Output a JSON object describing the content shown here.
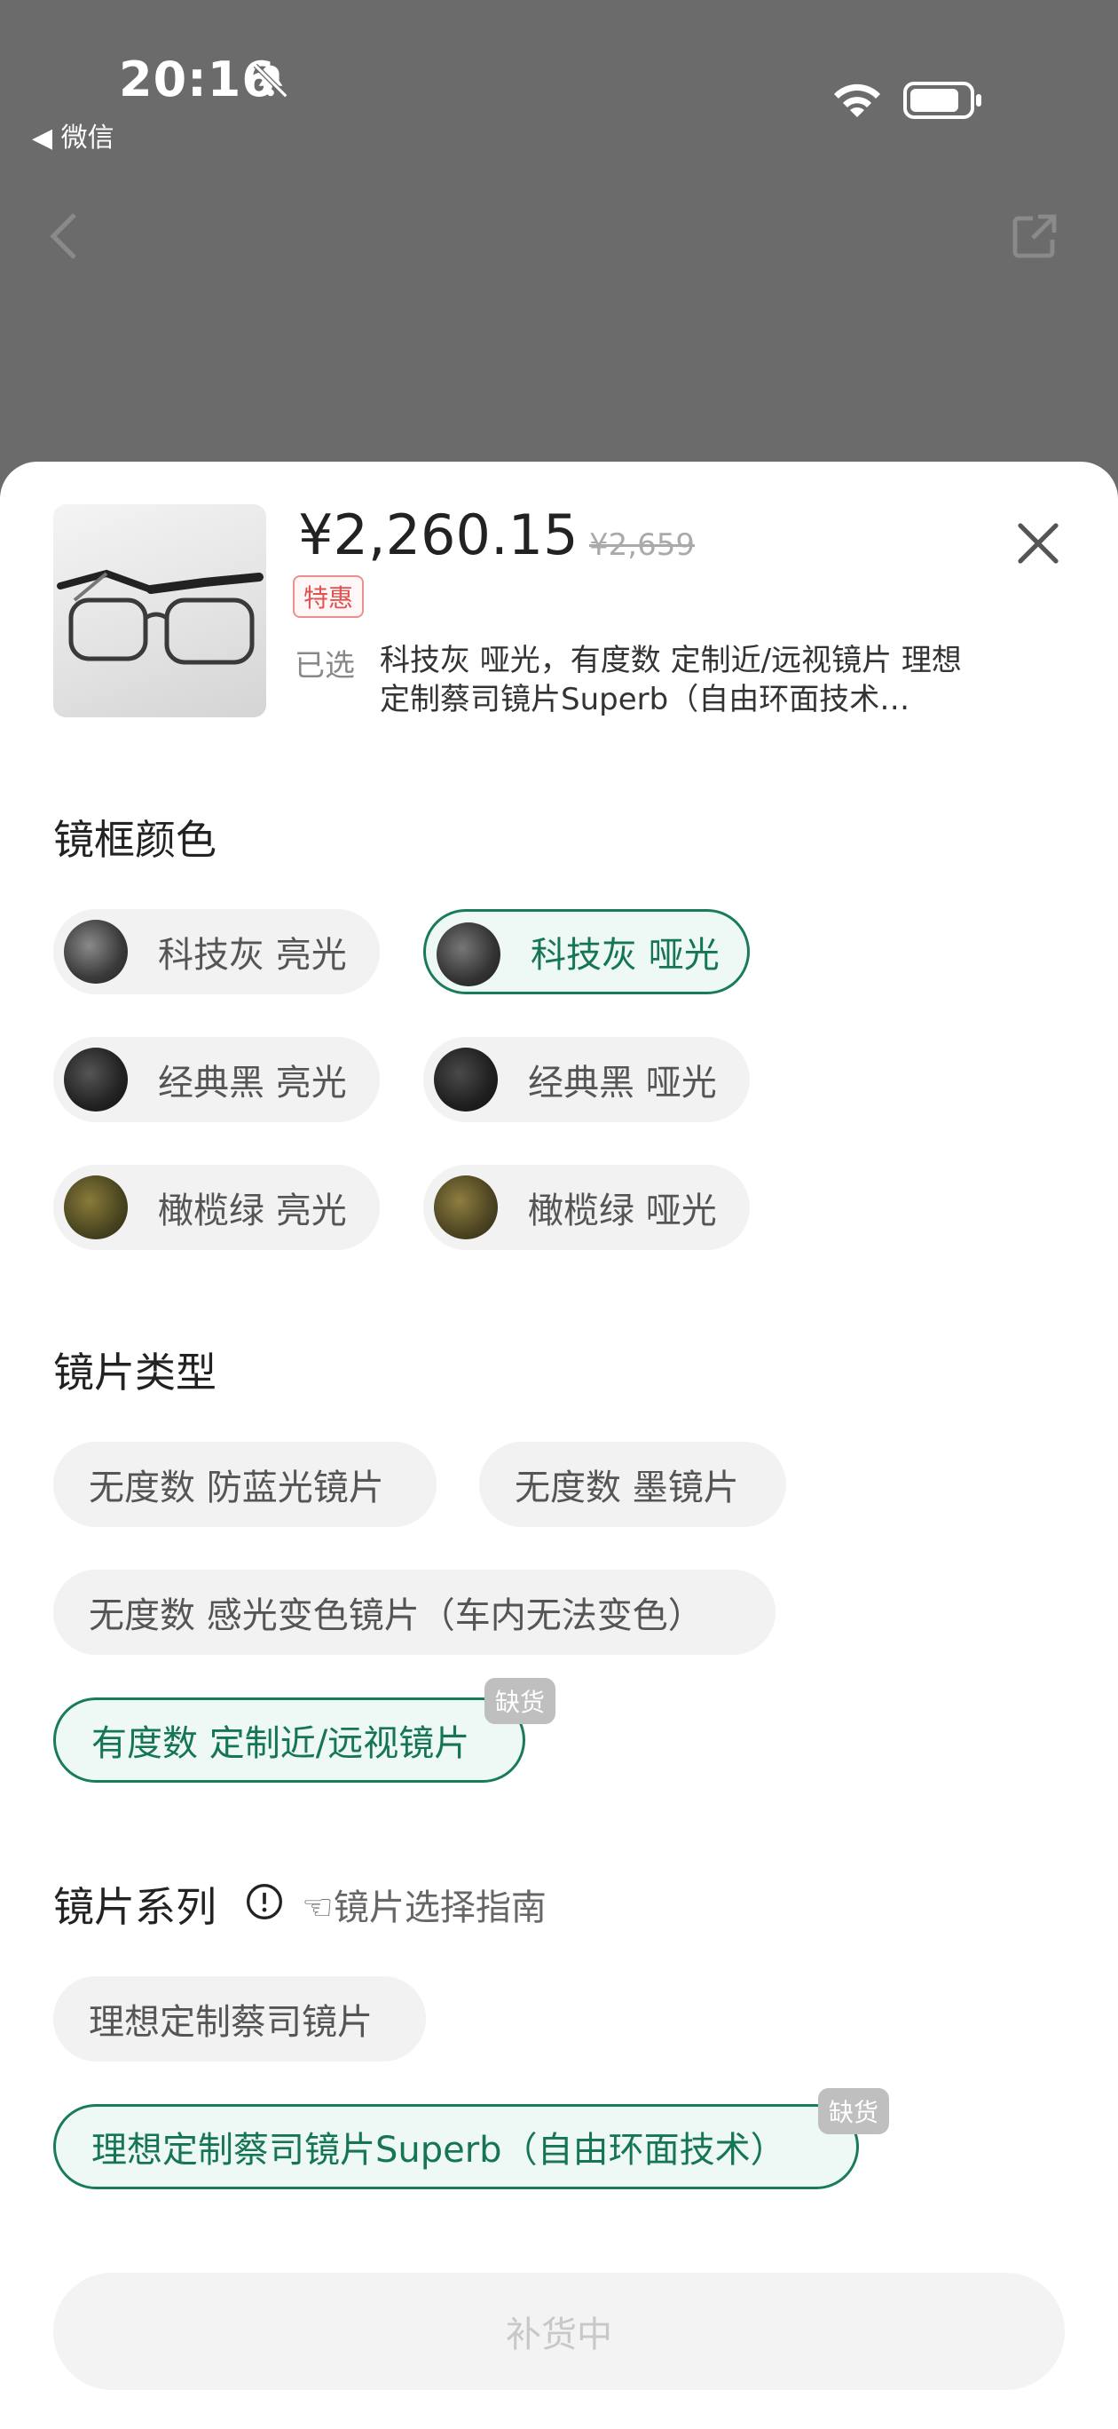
{
  "status_bar": {
    "time": "20:16",
    "back_app": "◀ 微信"
  },
  "product": {
    "price": "¥2,260.15",
    "original_price": "¥2,659",
    "promo_badge": "特惠",
    "selected_label": "已选",
    "selected_text": "科技灰 哑光，有度数 定制近/远视镜片 理想定制蔡司镜片Superb（自由环面技术…"
  },
  "frame_color": {
    "title": "镜框颜色",
    "options": [
      {
        "label": "科技灰 亮光",
        "selected": false,
        "swatch": "#4a4a4a"
      },
      {
        "label": "科技灰 哑光",
        "selected": true,
        "swatch": "#3e3e3e"
      },
      {
        "label": "经典黑 亮光",
        "selected": false,
        "swatch": "#222222"
      },
      {
        "label": "经典黑 哑光",
        "selected": false,
        "swatch": "#1f1f1f"
      },
      {
        "label": "橄榄绿 亮光",
        "selected": false,
        "swatch": "#4a4520"
      },
      {
        "label": "橄榄绿 哑光",
        "selected": false,
        "swatch": "#4d4522"
      }
    ]
  },
  "lens_type": {
    "title": "镜片类型",
    "options": [
      {
        "label": "无度数 防蓝光镜片",
        "selected": false
      },
      {
        "label": "无度数 墨镜片",
        "selected": false
      },
      {
        "label": "无度数 感光变色镜片（车内无法变色）",
        "selected": false
      },
      {
        "label": "有度数 定制近/远视镜片",
        "selected": true,
        "badge": "缺货"
      }
    ]
  },
  "lens_series": {
    "title": "镜片系列",
    "guide": "☜镜片选择指南",
    "options": [
      {
        "label": "理想定制蔡司镜片",
        "selected": false
      },
      {
        "label": "理想定制蔡司镜片Superb（自由环面技术）",
        "selected": true,
        "badge": "缺货"
      }
    ]
  },
  "action_button": {
    "label": "补货中"
  },
  "colors": {
    "accent": "#1a7a5c",
    "selected_bg": "#eef8f4",
    "promo": "#e25050",
    "chip_bg": "#f2f2f2"
  }
}
